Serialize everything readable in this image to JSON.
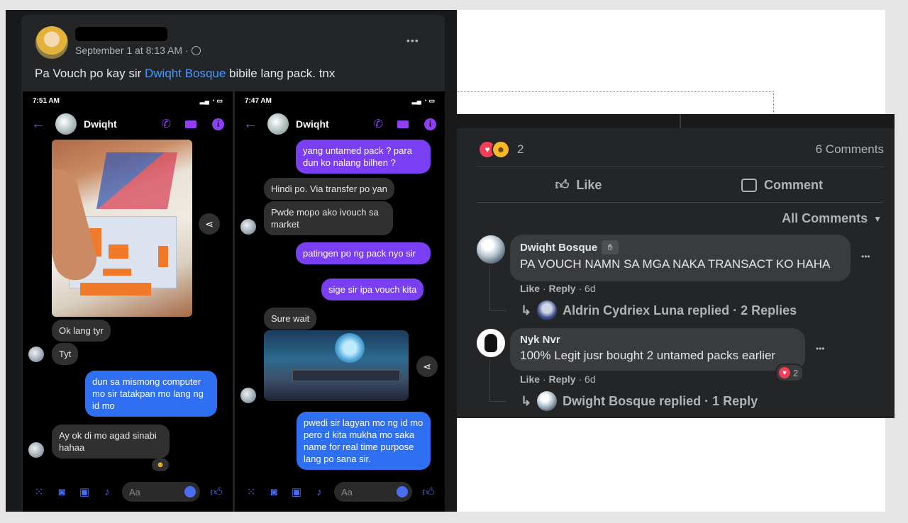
{
  "post": {
    "timestamp": "September 1 at 8:13 AM · ",
    "caption_before": "Pa Vouch po kay sir ",
    "caption_link": "Dwiqht Bosque",
    "caption_after": "  bibile lang pack. tnx",
    "more_glyph": "•••"
  },
  "phone1": {
    "time": "7:51 AM",
    "contact": "Dwiqht",
    "bubbles": [
      "Ok lang tyr",
      "Tyt",
      "dun sa mismong computer mo sir tatakpan mo lang ng id mo",
      "Ay ok di mo agad sinabi hahaa"
    ],
    "input_placeholder": "Aa"
  },
  "phone2": {
    "time": "7:47 AM",
    "contact": "Dwiqht",
    "bubbles": [
      "yang untamed pack ? para dun ko nalang bilhen ?",
      "Hindi po. Via transfer po yan",
      "Pwde mopo ako ivouch sa market",
      "patingen po ng pack nyo sir",
      "sige sir ipa vouch kita",
      "Sure wait",
      "pwedi sir lagyan mo ng id mo pero d kita mukha mo saka name for real time purpose lang po sana sir."
    ],
    "input_placeholder": "Aa"
  },
  "reactions": {
    "count": "2",
    "comments": "6 Comments"
  },
  "actions": {
    "like": "Like",
    "comment": "Comment"
  },
  "filter": {
    "label": "All Comments"
  },
  "comments": [
    {
      "name": "Dwiqht Bosque",
      "text": "PA VOUCH NAMN SA MGA NAKA TRANSACT KO HAHA",
      "like": "Like",
      "reply": "Reply",
      "age": "6d",
      "replies_label": "Aldrin Cydriex Luna replied · 2 Replies"
    },
    {
      "name": "Nyk Nvr",
      "text": "100% Legit jusr bought 2 untamed packs earlier",
      "like": "Like",
      "reply": "Reply",
      "age": "6d",
      "reaction_count": "2",
      "replies_label": "Dwight Bosque replied · 1 Reply"
    }
  ],
  "colors": {
    "link": "#4599ff",
    "bg_dark": "#242526",
    "bubble_blue": "#2f6ff1",
    "bubble_purple": "#7a3ff3",
    "heart": "#f33e58"
  },
  "icons": [
    "back-arrow-icon",
    "phone-icon",
    "video-icon",
    "info-icon",
    "share-icon",
    "camera-icon",
    "gallery-icon",
    "mic-icon",
    "thumbs-up-icon",
    "emoji-icon",
    "comment-icon",
    "dropdown-caret-icon",
    "reply-arrow-icon",
    "heart-icon",
    "haha-icon",
    "globe-icon"
  ]
}
